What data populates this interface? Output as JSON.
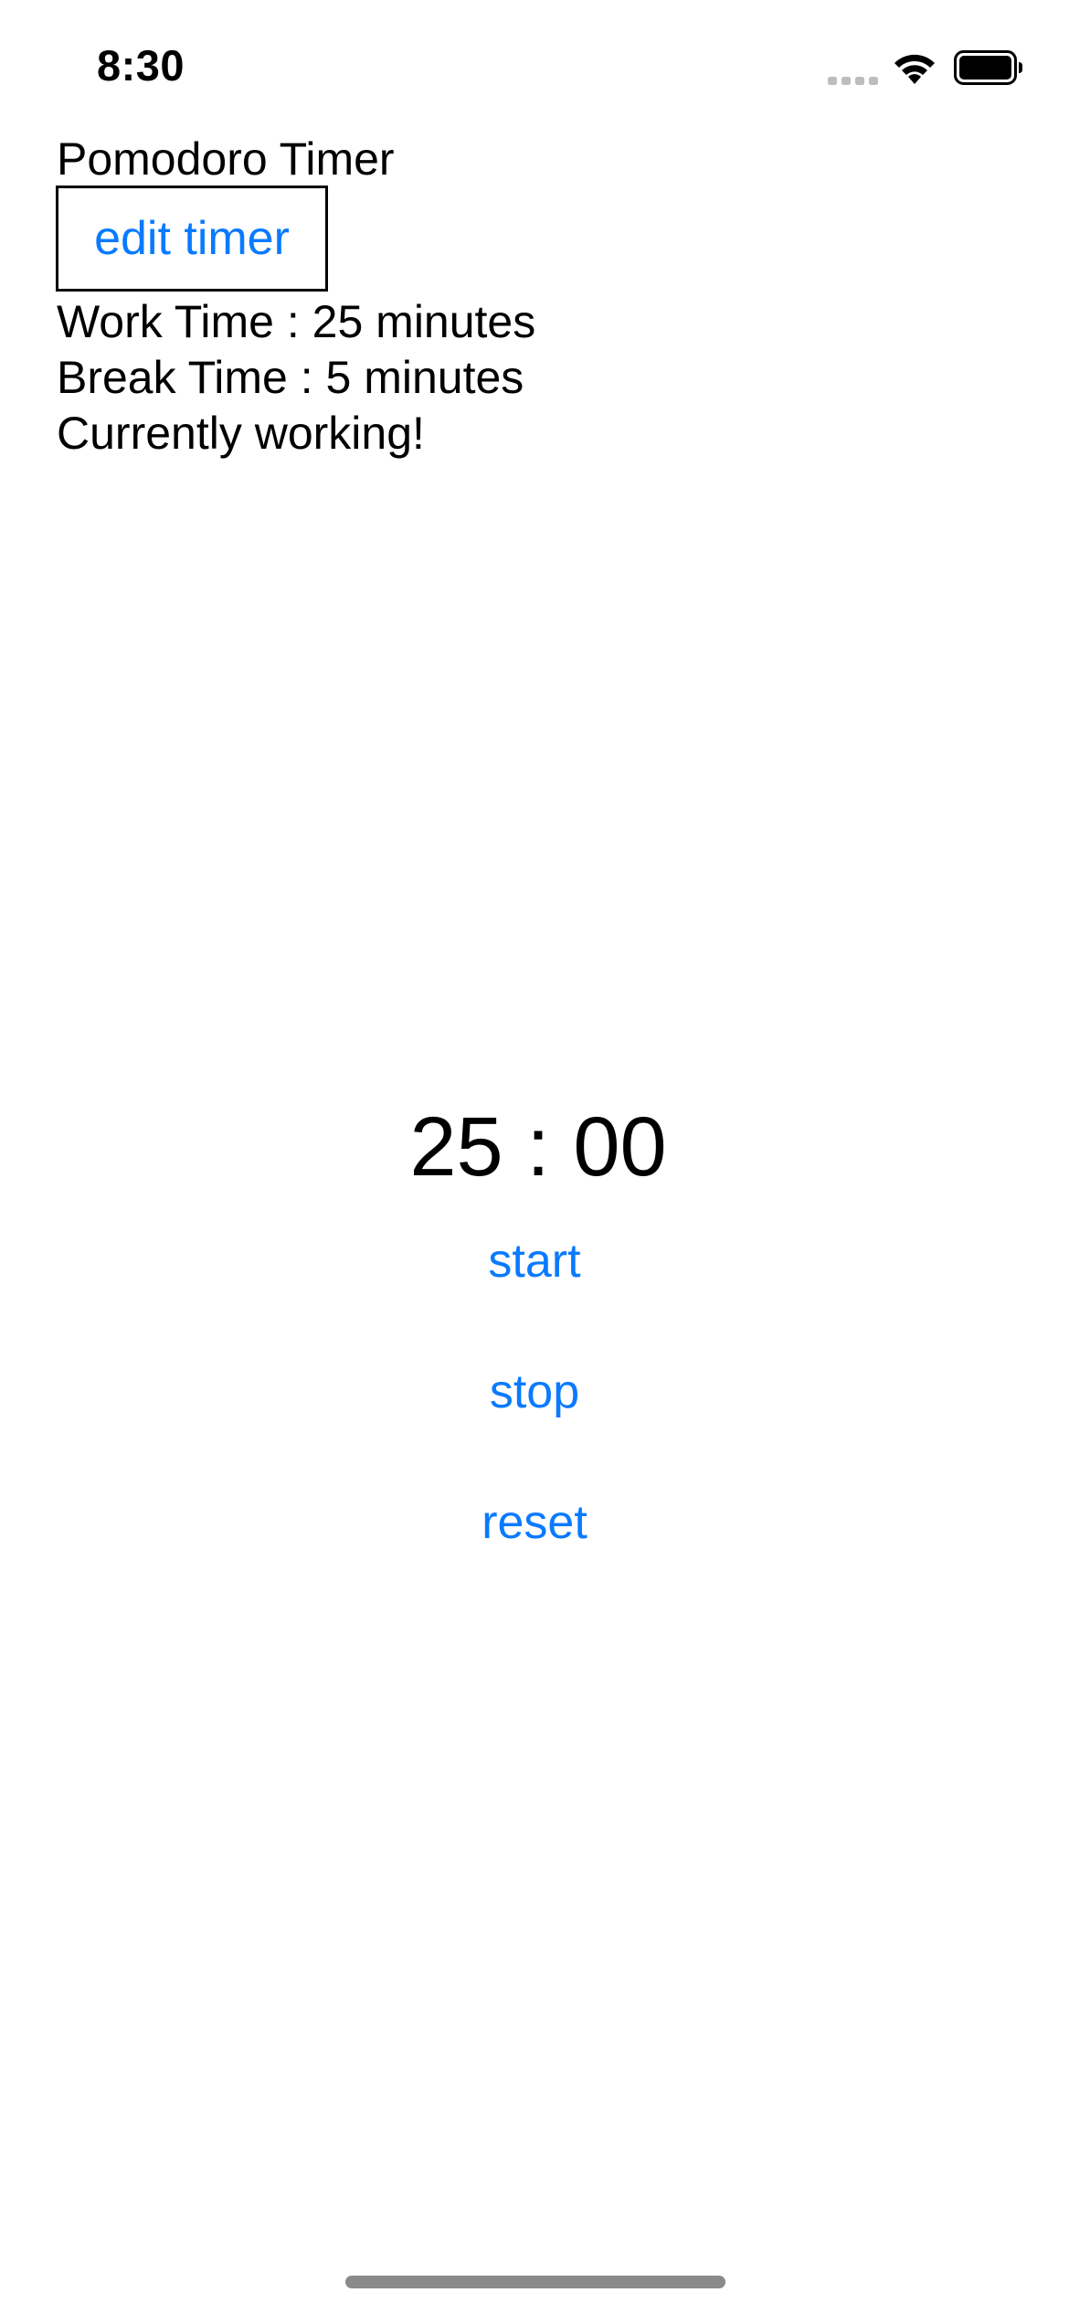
{
  "status_bar": {
    "time": "8:30",
    "icons": [
      "signal-icon",
      "wifi-icon",
      "battery-icon"
    ]
  },
  "header": {
    "title": "Pomodoro Timer",
    "edit_button_label": "edit timer"
  },
  "info": {
    "work_time": "Work Time : 25 minutes",
    "break_time": "Break Time : 5 minutes",
    "status": "Currently working!"
  },
  "timer": {
    "display": "25 : 00"
  },
  "controls": {
    "start_label": "start",
    "stop_label": "stop",
    "reset_label": "reset"
  },
  "colors": {
    "accent": "#0a7aff",
    "text": "#000000",
    "background": "#ffffff"
  }
}
